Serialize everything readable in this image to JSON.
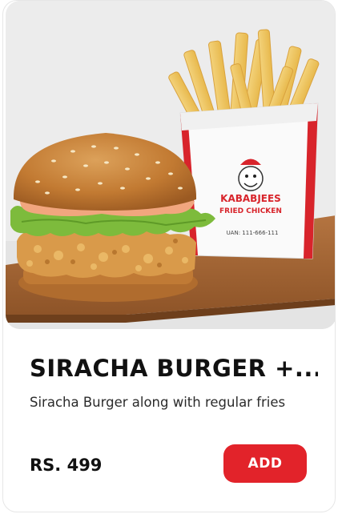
{
  "product": {
    "title": "SIRACHA BURGER +...",
    "description": "Siracha Burger along with regular fries",
    "price": "RS. 499",
    "add_label": "ADD"
  },
  "photo": {
    "brand_line1": "KABABJEES",
    "brand_line2": "FRIED CHICKEN",
    "uan": "UAN: 111-666-111"
  },
  "colors": {
    "accent": "#e2232a",
    "title": "#111111",
    "text": "#2b2b2b"
  }
}
